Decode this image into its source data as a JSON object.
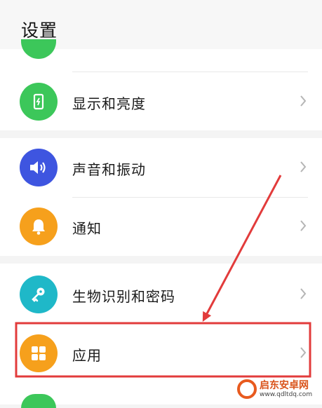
{
  "header": {
    "title": "设置"
  },
  "items": [
    {
      "label": "显示和亮度",
      "icon": "display-brightness-icon",
      "color": "#3cc75a"
    },
    {
      "label": "声音和振动",
      "icon": "speaker-icon",
      "color": "#3e55e0"
    },
    {
      "label": "通知",
      "icon": "bell-icon",
      "color": "#f6a01c"
    },
    {
      "label": "生物识别和密码",
      "icon": "key-icon",
      "color": "#1fb8c8"
    },
    {
      "label": "应用",
      "icon": "apps-grid-icon",
      "color": "#f6a01c"
    }
  ],
  "highlight_color": "#e23b3b",
  "watermark": {
    "name": "启东安卓网",
    "url": "www.qdltdq.com"
  }
}
